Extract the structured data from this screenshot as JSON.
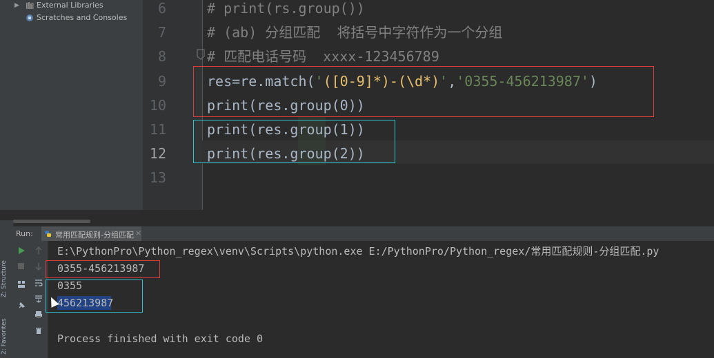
{
  "side_tabs": {
    "structure": "Z: Structure",
    "favorites": "2: Favorites"
  },
  "project_tree": [
    {
      "label": "External Libraries",
      "icon": "library-icon",
      "expandable": true
    },
    {
      "label": "Scratches and Consoles",
      "icon": "scratches-icon",
      "expandable": false
    }
  ],
  "editor": {
    "current_line": 12,
    "lines": [
      {
        "num": "6",
        "parts": [
          {
            "t": "# print(rs.group())",
            "c": "comment"
          }
        ]
      },
      {
        "num": "7",
        "parts": [
          {
            "t": "# (ab) 分组匹配  将括号中字符作为一个分组",
            "c": "comment"
          }
        ]
      },
      {
        "num": "8",
        "parts": [
          {
            "t": "# 匹配电话号码  xxxx-123456789",
            "c": "comment"
          }
        ]
      },
      {
        "num": "9",
        "parts": [
          {
            "t": "res=re.match(",
            "c": "plain"
          },
          {
            "t": "'",
            "c": "str"
          },
          {
            "t": "([0-9]*)-(\\d*)",
            "c": "rx"
          },
          {
            "t": "'",
            "c": "str"
          },
          {
            "t": ",",
            "c": "plain"
          },
          {
            "t": "'0355-456213987'",
            "c": "str"
          },
          {
            "t": ")",
            "c": "plain"
          }
        ]
      },
      {
        "num": "10",
        "parts": [
          {
            "t": "print(res.group(0))",
            "c": "plain"
          }
        ]
      },
      {
        "num": "11",
        "parts": [
          {
            "t": "print(res.group(1))",
            "c": "plain"
          }
        ]
      },
      {
        "num": "12",
        "parts": [
          {
            "t": "print(res.group(2))",
            "c": "plain"
          }
        ]
      },
      {
        "num": "13",
        "parts": []
      }
    ]
  },
  "run": {
    "label": "Run:",
    "tab_title": "常用匹配规则-分组匹配",
    "tab_close": "×",
    "output": [
      "E:\\PythonPro\\Python_regex\\venv\\Scripts\\python.exe E:/PythonPro/Python_regex/常用匹配规则-分组匹配.py",
      "0355-456213987",
      "0355",
      "456213987",
      "",
      "Process finished with exit code 0"
    ]
  },
  "colors": {
    "red_box": "#e03b3b",
    "cyan_box": "#2ec4d0",
    "selection": "#214283"
  }
}
